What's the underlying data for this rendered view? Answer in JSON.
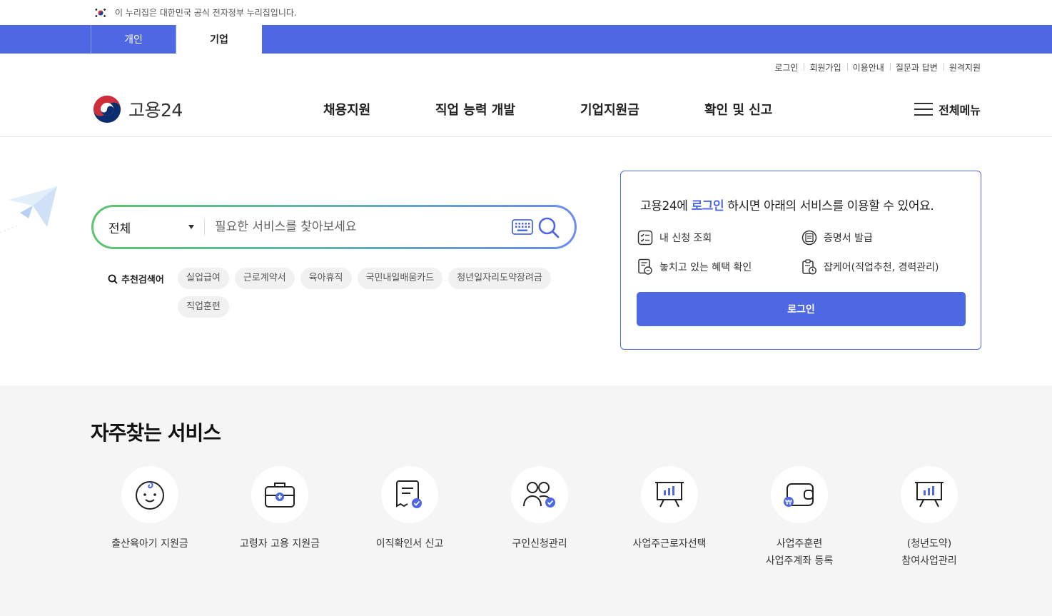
{
  "gov_banner": {
    "text": "이 누리집은 대한민국 공식 전자정부 누리집입니다.",
    "icon": "korea-flag-icon"
  },
  "audience_tabs": [
    {
      "label": "개인",
      "active": false
    },
    {
      "label": "기업",
      "active": true
    }
  ],
  "util_links": [
    "로그인",
    "회원가입",
    "이용안내",
    "질문과 답변",
    "원격지원"
  ],
  "logo": {
    "text": "고용24"
  },
  "main_menu": [
    "채용지원",
    "직업 능력 개발",
    "기업지원금",
    "확인 및 신고"
  ],
  "all_menu_label": "전체메뉴",
  "search": {
    "scope": "전체",
    "placeholder": "필요한 서비스를 찾아보세요"
  },
  "recommended": {
    "label": "추천검색어",
    "keywords": [
      "실업급여",
      "근로계약서",
      "육아휴직",
      "국민내일배움카드",
      "청년일자리도약장려금",
      "직업훈련"
    ]
  },
  "login_card": {
    "title_pre": "고용24에 ",
    "title_link": "로그인",
    "title_post": " 하시면 아래의 서비스를 이용할 수 있어요.",
    "services": [
      {
        "label": "내 신청 조회",
        "icon": "checklist-icon"
      },
      {
        "label": "증명서 발급",
        "icon": "certificate-icon"
      },
      {
        "label": "놓치고 있는 혜택 확인",
        "icon": "benefit-document-icon"
      },
      {
        "label": "잡케어(직업추천, 경력관리)",
        "icon": "jobcare-icon"
      }
    ],
    "button": "로그인"
  },
  "frequent": {
    "title": "자주찾는 서비스",
    "items": [
      {
        "label": "출산육아기 지원금",
        "icon": "baby-face-icon"
      },
      {
        "label": "고령자 고용 지원금",
        "icon": "briefcase-plus-icon"
      },
      {
        "label": "이직확인서 신고",
        "icon": "document-check-icon"
      },
      {
        "label": "구인신청관리",
        "icon": "people-check-icon"
      },
      {
        "label": "사업주근로자선택",
        "icon": "presentation-chart-icon"
      },
      {
        "label": "사업주훈련\n사업주계좌 등록",
        "icon": "wallet-won-icon"
      },
      {
        "label": "(청년도약)\n참여사업관리",
        "icon": "presentation-chart-icon"
      }
    ]
  },
  "colors": {
    "primary": "#4e67e3",
    "gradient_start": "#5bc46c",
    "gradient_end": "#6a8cf0"
  }
}
